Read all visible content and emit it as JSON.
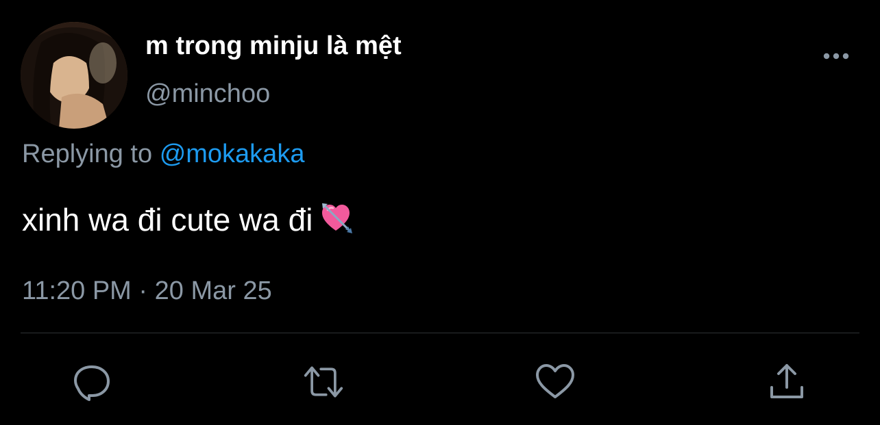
{
  "author": {
    "display_name": "m trong minju là mệt",
    "handle": "@minchoo"
  },
  "reply": {
    "prefix": "Replying to",
    "mention": "@mokakaka"
  },
  "tweet": {
    "text": "xinh wa đi cute wa đi",
    "emoji": "heart-with-arrow-icon"
  },
  "meta": {
    "time": "11:20 PM",
    "separator": "·",
    "date": "20 Mar 25"
  },
  "actions": [
    "reply-icon",
    "retweet-icon",
    "like-icon",
    "share-icon"
  ],
  "colors": {
    "background": "#000000",
    "primary_text": "#ffffff",
    "secondary_text": "#8b98a5",
    "link": "#1d9bf0",
    "divider": "#2f3336"
  }
}
